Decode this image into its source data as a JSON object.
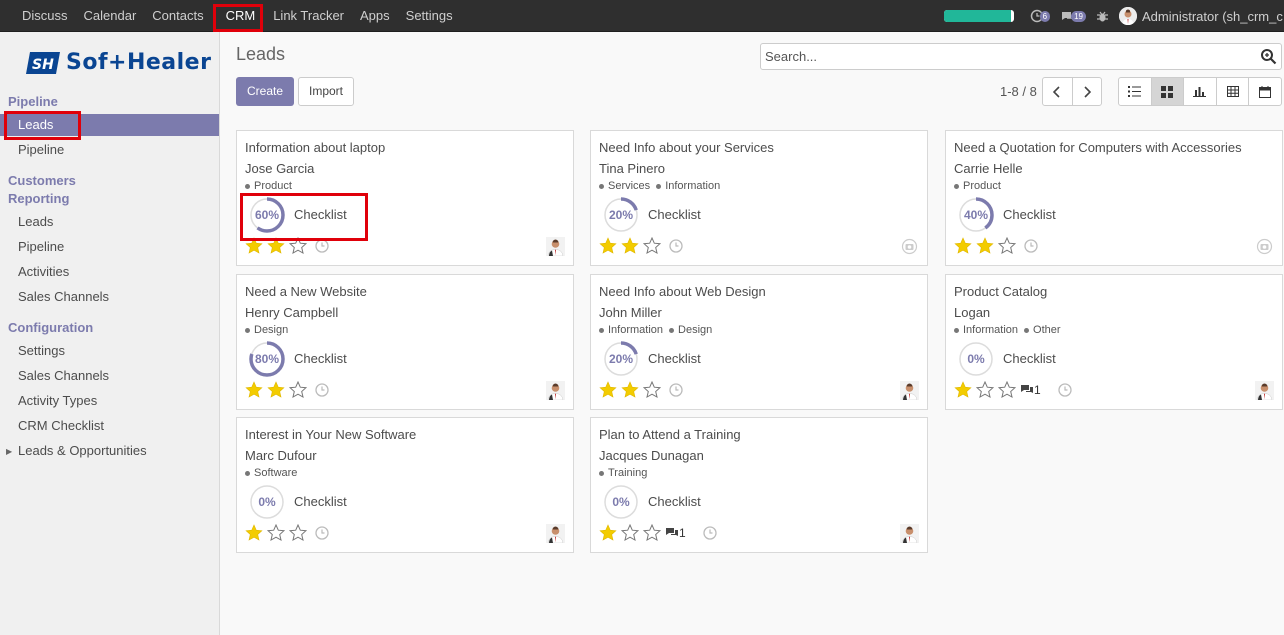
{
  "topbar": {
    "menu": [
      "Discuss",
      "Calendar",
      "Contacts",
      "CRM",
      "Link Tracker",
      "Apps",
      "Settings"
    ],
    "active": "CRM",
    "activities_count": "6",
    "messages_count": "19",
    "user": "Administrator (sh_crm_c",
    "accent": "#7c7bad",
    "progress_color": "#21b799"
  },
  "sidebar": {
    "logo_text": "Sof+Healer",
    "pipeline_header": "Pipeline",
    "leads": "Leads",
    "pipeline": "Pipeline",
    "customers_header": "Customers",
    "reporting_header": "Reporting",
    "reporting_items": [
      "Leads",
      "Pipeline",
      "Activities",
      "Sales Channels"
    ],
    "configuration_header": "Configuration",
    "configuration_items": [
      "Settings",
      "Sales Channels",
      "Activity Types",
      "CRM Checklist",
      "Leads & Opportunities"
    ]
  },
  "control": {
    "title": "Leads",
    "search_placeholder": "Search...",
    "create": "Create",
    "import": "Import",
    "pager": "1-8 / 8"
  },
  "cards": [
    {
      "title": "Information about laptop",
      "contact": "Jose Garcia",
      "tags": [
        "Product"
      ],
      "progress": 60,
      "pct": "60%",
      "checklist": "Checklist",
      "stars": 2,
      "messages": "",
      "assigned": true
    },
    {
      "title": "Need Info about your Services",
      "contact": "Tina Pinero",
      "tags": [
        "Services",
        "Information"
      ],
      "progress": 20,
      "pct": "20%",
      "checklist": "Checklist",
      "stars": 2,
      "messages": "",
      "assigned": false
    },
    {
      "title": "Need a Quotation for Computers with Accessories",
      "contact": "Carrie Helle",
      "tags": [
        "Product"
      ],
      "progress": 40,
      "pct": "40%",
      "checklist": "Checklist",
      "stars": 2,
      "messages": "",
      "assigned": false
    },
    {
      "title": "Need a New Website",
      "contact": "Henry Campbell",
      "tags": [
        "Design"
      ],
      "progress": 80,
      "pct": "80%",
      "checklist": "Checklist",
      "stars": 2,
      "messages": "",
      "assigned": true
    },
    {
      "title": "Need Info about Web Design",
      "contact": "John Miller",
      "tags": [
        "Information",
        "Design"
      ],
      "progress": 20,
      "pct": "20%",
      "checklist": "Checklist",
      "stars": 2,
      "messages": "",
      "assigned": true
    },
    {
      "title": "Product Catalog",
      "contact": "Logan",
      "tags": [
        "Information",
        "Other"
      ],
      "progress": 0,
      "pct": "0%",
      "checklist": "Checklist",
      "stars": 1,
      "messages": "1",
      "assigned": true
    },
    {
      "title": "Interest in Your New Software",
      "contact": "Marc Dufour",
      "tags": [
        "Software"
      ],
      "progress": 0,
      "pct": "0%",
      "checklist": "Checklist",
      "stars": 1,
      "messages": "",
      "assigned": true
    },
    {
      "title": "Plan to Attend a Training",
      "contact": "Jacques Dunagan",
      "tags": [
        "Training"
      ],
      "progress": 0,
      "pct": "0%",
      "checklist": "Checklist",
      "stars": 1,
      "messages": "1",
      "assigned": true
    }
  ]
}
